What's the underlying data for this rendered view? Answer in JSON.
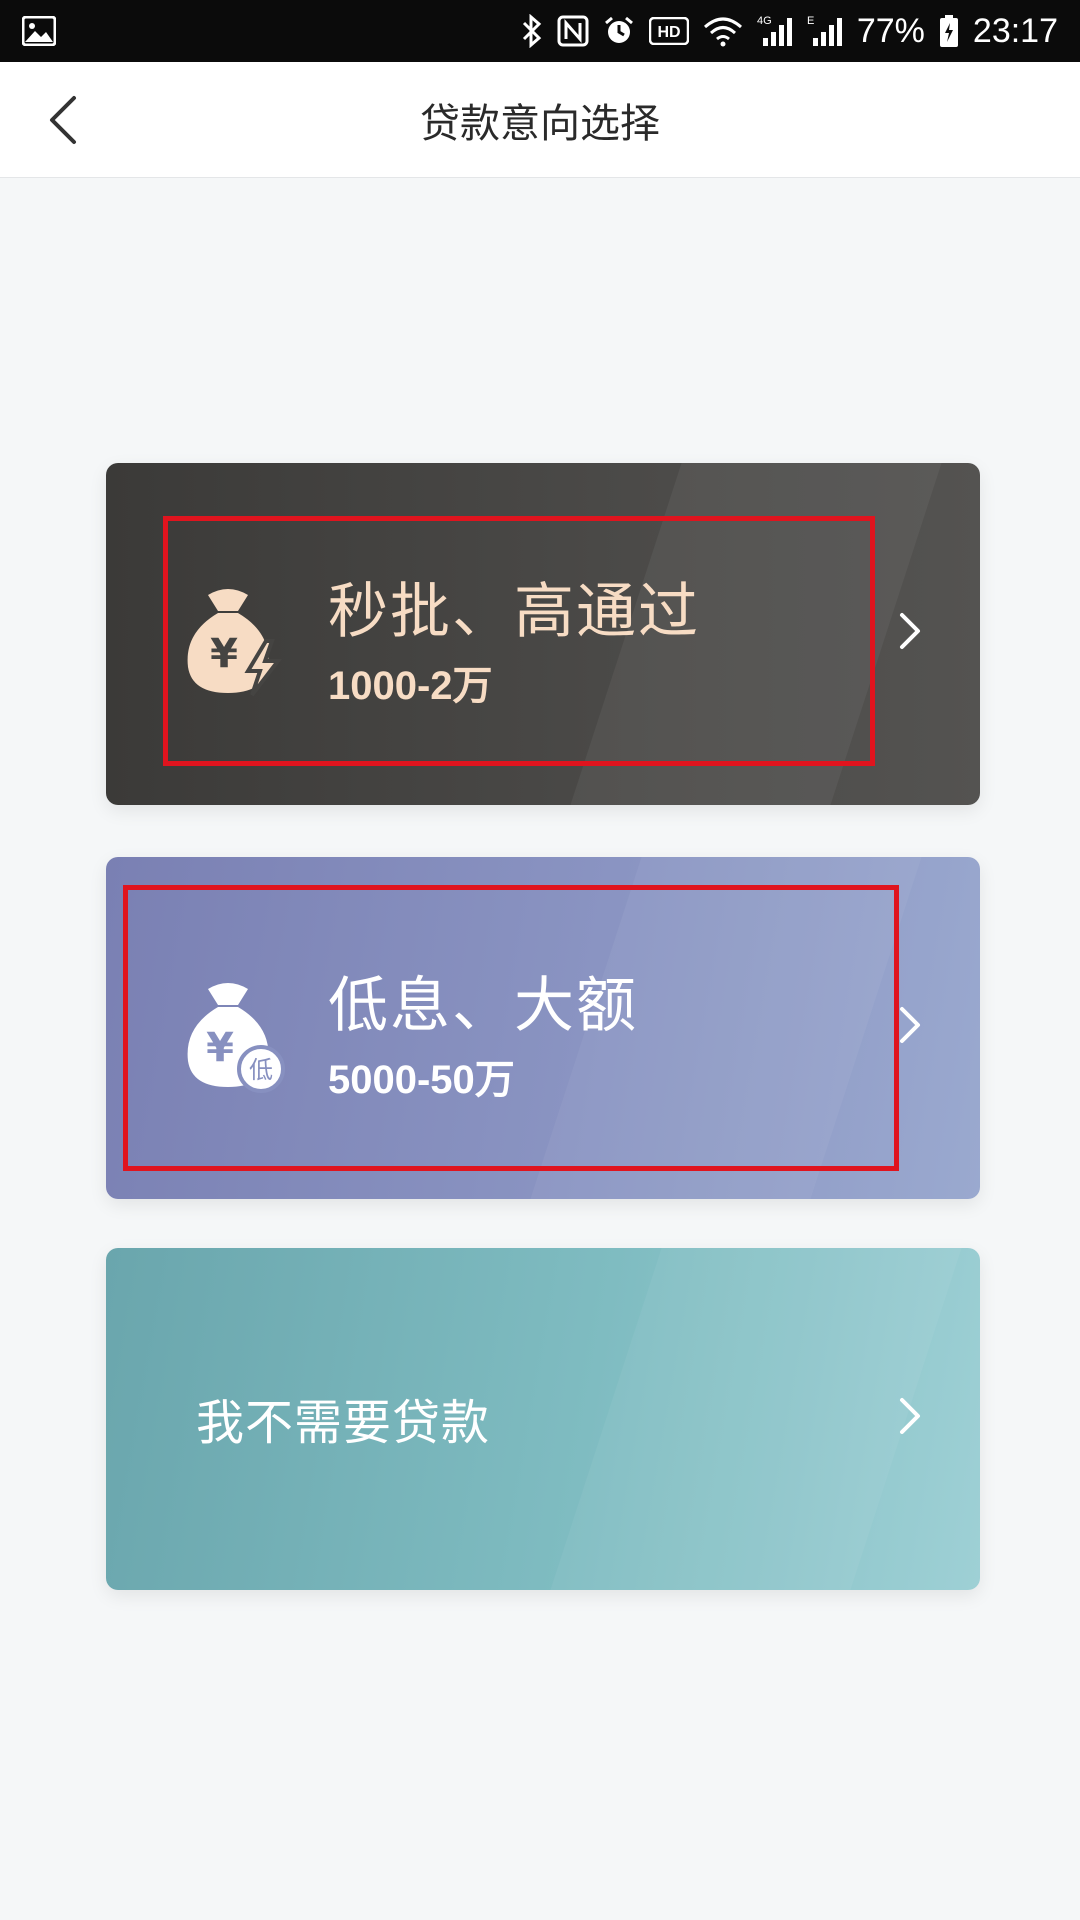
{
  "status_bar": {
    "battery": "77%",
    "time": "23:17",
    "hd_label": "HD",
    "network_4g": "4G",
    "network_e": "E",
    "icons": [
      "gallery-icon",
      "bluetooth-icon",
      "nfc-icon",
      "alarm-icon",
      "hd-icon",
      "wifi-icon",
      "signal-icon",
      "battery-icon"
    ]
  },
  "header": {
    "title": "贷款意向选择",
    "back_icon": "chevron-left-icon"
  },
  "options": [
    {
      "title": "秒批、高通过",
      "subtitle": "1000-2万",
      "icon": "money-bag-lightning-icon",
      "accent": "#f7dcc4"
    },
    {
      "title": "低息、大额",
      "subtitle": "5000-50万",
      "icon": "money-bag-low-icon",
      "badge": "低",
      "accent": "#ffffff"
    },
    {
      "title": "我不需要贷款",
      "accent": "#ffffff"
    }
  ],
  "colors": {
    "highlight": "#e0141e",
    "card1": "#454442",
    "card2": "#8790c0",
    "card3": "#7dbbc0"
  }
}
